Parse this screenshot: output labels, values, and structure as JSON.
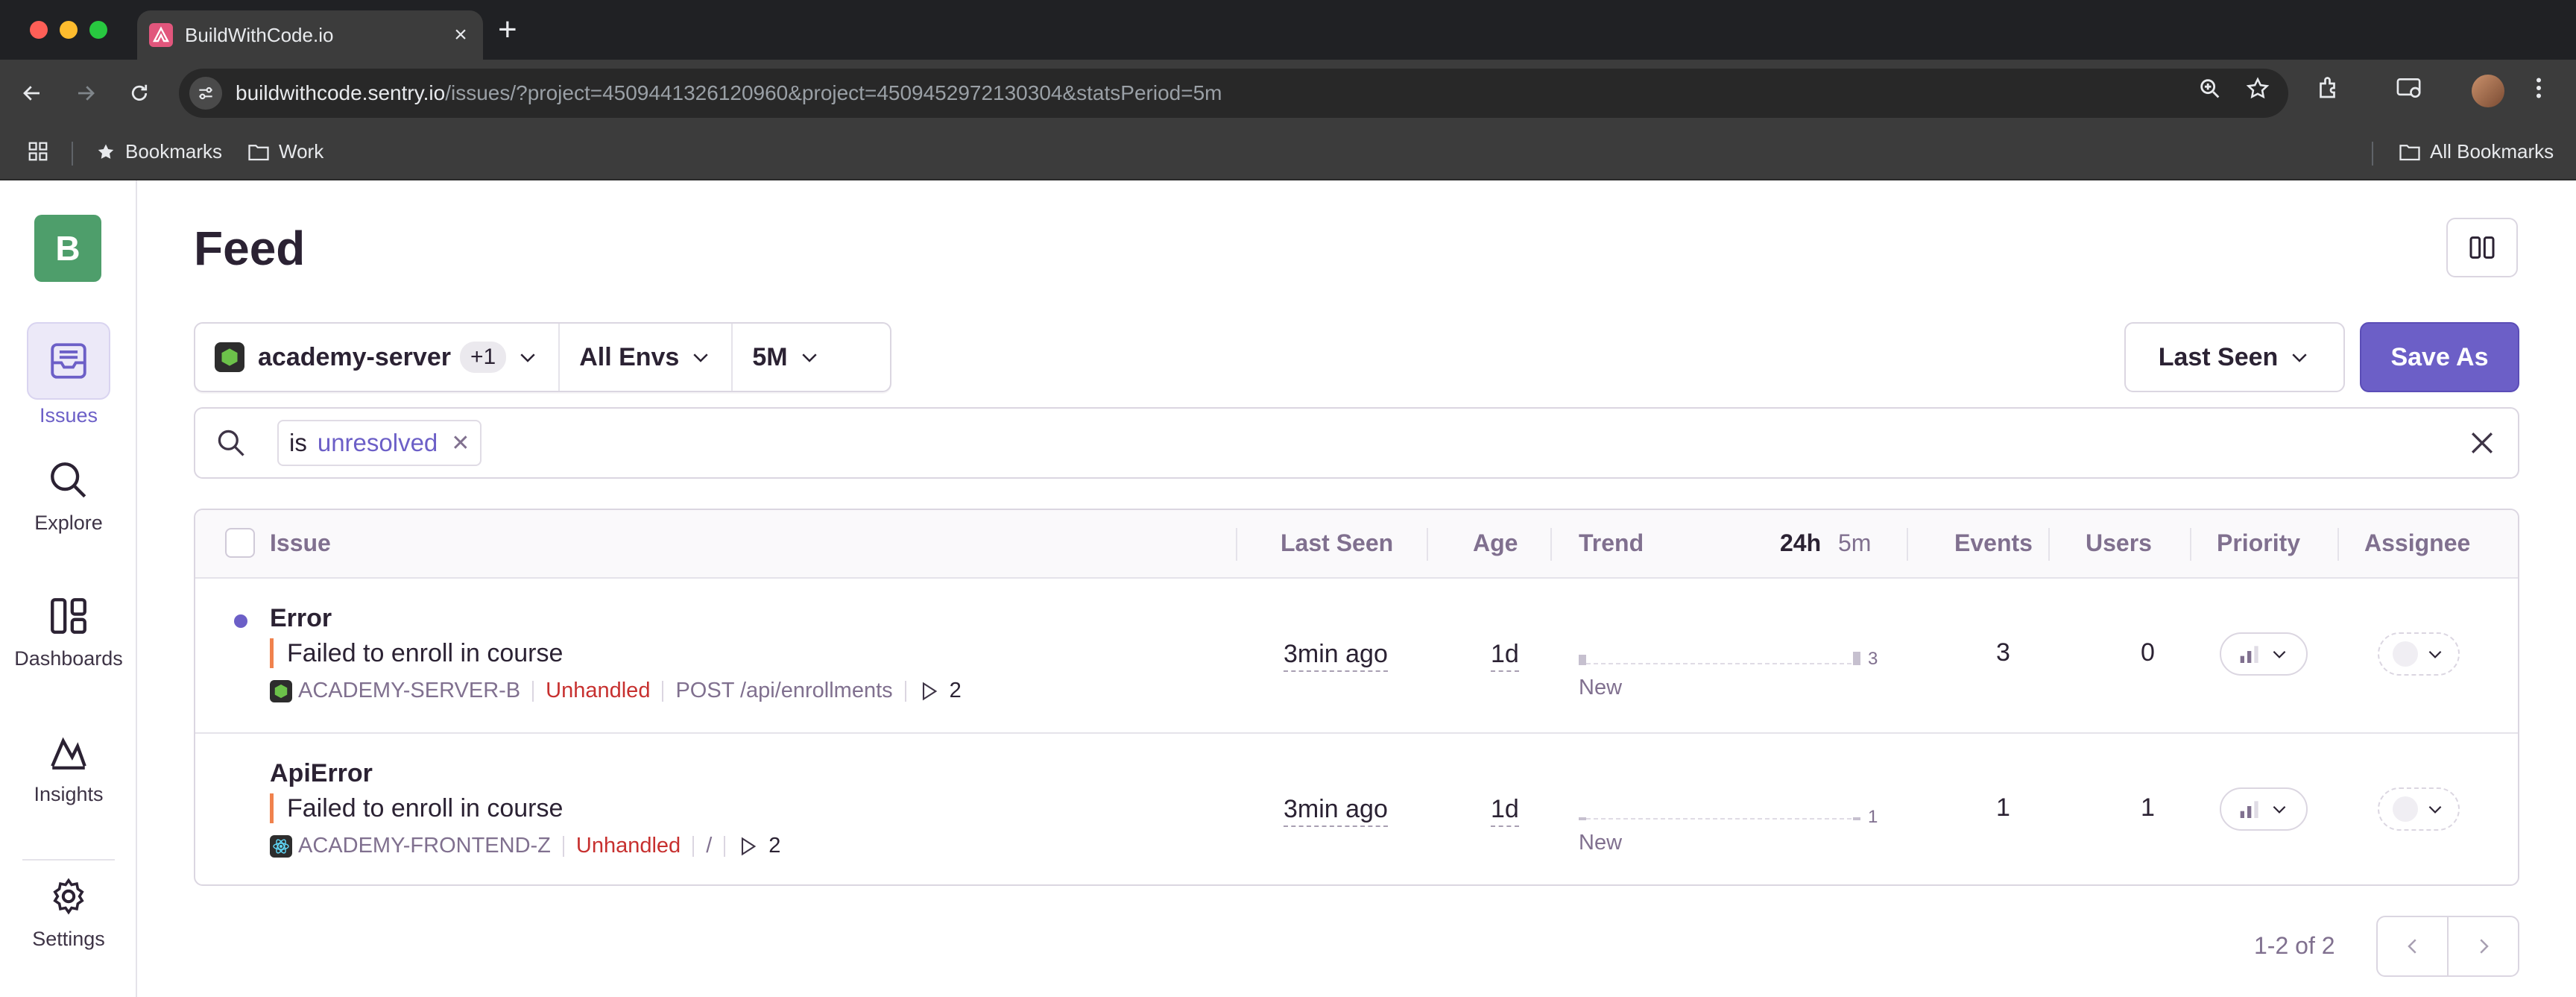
{
  "browser": {
    "tab_title": "BuildWithCode.io",
    "url_host": "buildwithcode.sentry.io",
    "url_path": "/issues/?project=4509441326120960&project=4509452972130304&statsPeriod=5m",
    "bookmarks": [
      "Bookmarks",
      "Work"
    ],
    "all_bookmarks": "All Bookmarks"
  },
  "sidebar": {
    "org_initial": "B",
    "items": [
      {
        "label": "Issues",
        "icon": "inbox-icon",
        "active": true
      },
      {
        "label": "Explore",
        "icon": "search-icon"
      },
      {
        "label": "Dashboards",
        "icon": "dashboards-icon"
      },
      {
        "label": "Insights",
        "icon": "insights-icon"
      },
      {
        "label": "Settings",
        "icon": "gear-icon"
      }
    ]
  },
  "page": {
    "title": "Feed"
  },
  "filters": {
    "project": "academy-server",
    "project_extra": "+1",
    "environment": "All Envs",
    "period": "5M",
    "sort": "Last Seen",
    "save_as": "Save As"
  },
  "search": {
    "token_key": "is",
    "token_value": "unresolved"
  },
  "table": {
    "headers": {
      "issue": "Issue",
      "last_seen": "Last Seen",
      "age": "Age",
      "trend": "Trend",
      "period_24h": "24h",
      "period_5m": "5m",
      "events": "Events",
      "users": "Users",
      "priority": "Priority",
      "assignee": "Assignee"
    },
    "rows": [
      {
        "title": "Error",
        "message": "Failed to enroll in course",
        "project": "ACADEMY-SERVER-B",
        "handled": "Unhandled",
        "culprit": "POST /api/enrollments",
        "replays": "2",
        "last_seen": "3min ago",
        "age": "1d",
        "trend_max": "3",
        "trend_label": "New",
        "events": "3",
        "users": "0",
        "unread": true
      },
      {
        "title": "ApiError",
        "message": "Failed to enroll in course",
        "project": "ACADEMY-FRONTEND-Z",
        "handled": "Unhandled",
        "culprit": "/",
        "replays": "2",
        "last_seen": "3min ago",
        "age": "1d",
        "trend_max": "1",
        "trend_label": "New",
        "events": "1",
        "users": "1",
        "unread": false
      }
    ]
  },
  "pagination": {
    "count": "1-2 of 2"
  },
  "colors": {
    "accent": "#6c5fc7",
    "unhandled": "#c7302f",
    "level_bar": "#f0824d",
    "org_badge": "#4e9e6b"
  }
}
